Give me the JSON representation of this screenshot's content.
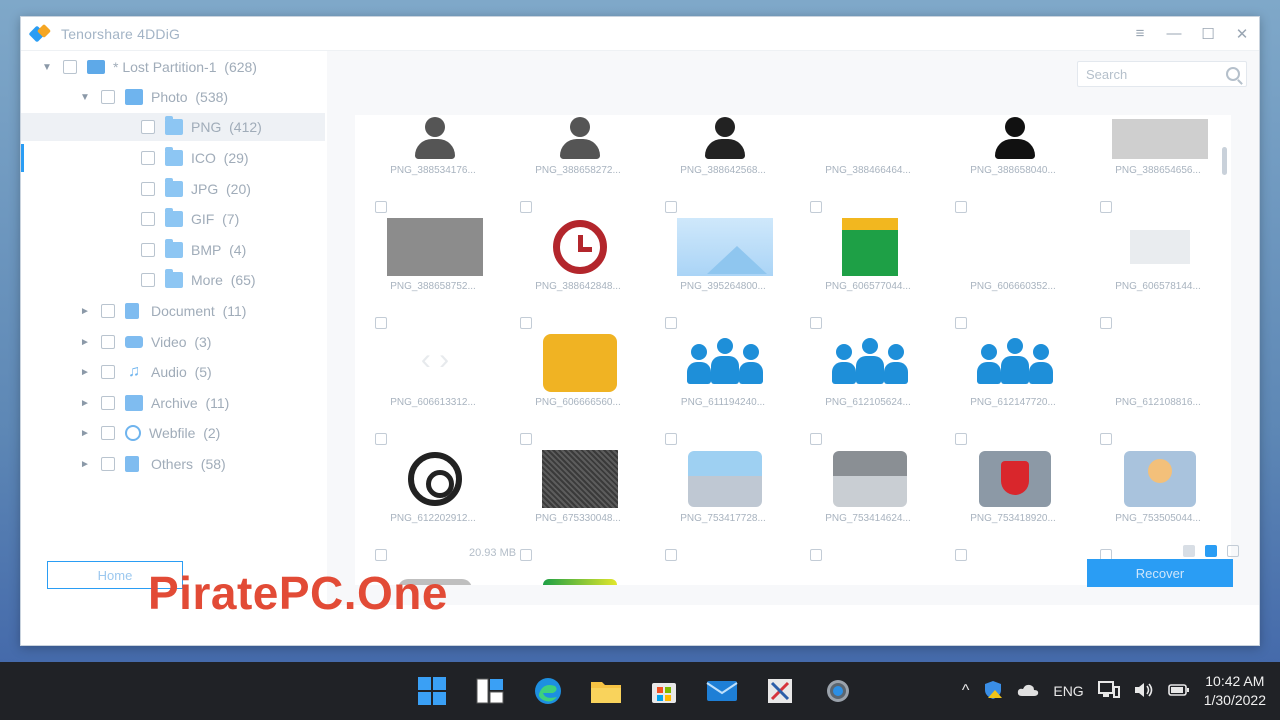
{
  "window": {
    "title": "Tenorshare 4DDiG",
    "controls": [
      "≡",
      "—",
      "☐",
      "✕"
    ]
  },
  "sidebar": {
    "root": {
      "label": "* Lost Partition-1",
      "count": "(628)"
    },
    "photo": {
      "label": "Photo",
      "count": "(538)"
    },
    "photo_children": [
      {
        "label": "PNG",
        "count": "(412)"
      },
      {
        "label": "ICO",
        "count": "(29)"
      },
      {
        "label": "JPG",
        "count": "(20)"
      },
      {
        "label": "GIF",
        "count": "(7)"
      },
      {
        "label": "BMP",
        "count": "(4)"
      },
      {
        "label": "More",
        "count": "(65)"
      }
    ],
    "categories": [
      {
        "label": "Document",
        "count": "(11)"
      },
      {
        "label": "Video",
        "count": "(3)"
      },
      {
        "label": "Audio",
        "count": "(5)"
      },
      {
        "label": "Archive",
        "count": "(11)"
      },
      {
        "label": "Webfile",
        "count": "(2)"
      },
      {
        "label": "Others",
        "count": "(58)"
      }
    ]
  },
  "search": {
    "placeholder": "Search"
  },
  "grid": {
    "files": [
      "PNG_388534176...",
      "PNG_388658272...",
      "PNG_388642568...",
      "PNG_388466464...",
      "PNG_388658040...",
      "PNG_388654656...",
      "PNG_388658752...",
      "PNG_388642848...",
      "PNG_395264800...",
      "PNG_606577044...",
      "PNG_606660352...",
      "PNG_606578144...",
      "PNG_606613312...",
      "PNG_606666560...",
      "PNG_611194240...",
      "PNG_612105624...",
      "PNG_612147720...",
      "PNG_612108816...",
      "PNG_612202912...",
      "PNG_675330048...",
      "PNG_753417728...",
      "PNG_753414624...",
      "PNG_753418920...",
      "PNG_753505044..."
    ]
  },
  "status": {
    "text": "20.93 MB"
  },
  "buttons": {
    "home": "Home",
    "recover": "Recover"
  },
  "watermark": "PiratePC.One",
  "taskbar": {
    "language": "ENG",
    "time": "10:42 AM",
    "date": "1/30/2022"
  },
  "colors": {
    "accent": "#2a9df4",
    "watermark": "#e24b36",
    "taskbar": "#202226"
  }
}
